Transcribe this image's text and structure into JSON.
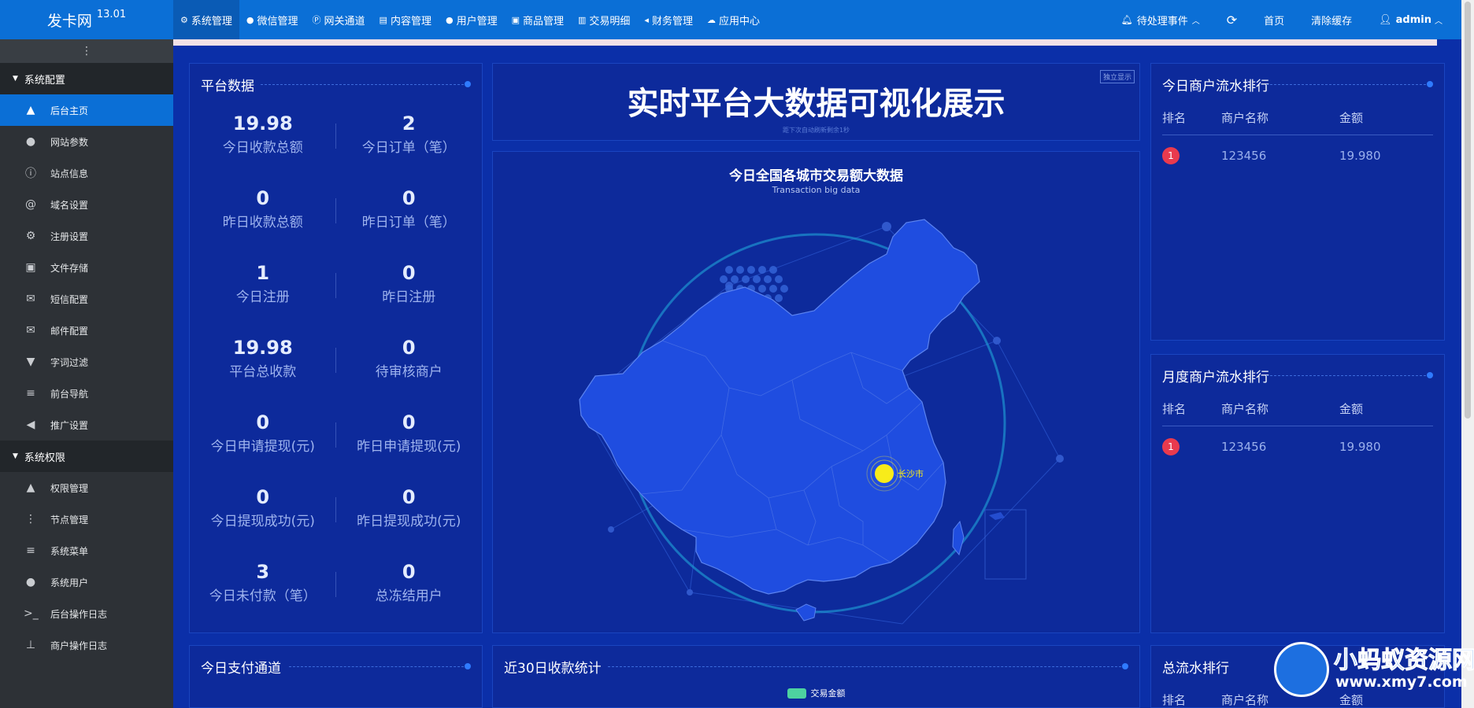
{
  "brand": {
    "name": "发卡网",
    "version": "13.01"
  },
  "topnav": [
    {
      "icon": "gear-icon",
      "glyph": "⚙",
      "label": "系统管理",
      "active": true
    },
    {
      "icon": "wechat-icon",
      "glyph": "●",
      "label": "微信管理"
    },
    {
      "icon": "gateway-icon",
      "glyph": "Ⓟ",
      "label": "网关通道"
    },
    {
      "icon": "file-icon",
      "glyph": "▤",
      "label": "内容管理"
    },
    {
      "icon": "users-icon",
      "glyph": "●",
      "label": "用户管理"
    },
    {
      "icon": "shop-icon",
      "glyph": "▣",
      "label": "商品管理"
    },
    {
      "icon": "bar-chart-icon",
      "glyph": "▥",
      "label": "交易明细"
    },
    {
      "icon": "finance-icon",
      "glyph": "◂",
      "label": "财务管理"
    },
    {
      "icon": "cloud-icon",
      "glyph": "☁",
      "label": "应用中心"
    }
  ],
  "topright": {
    "pending": "待处理事件",
    "refresh_glyph": "⟳",
    "home": "首页",
    "clear_cache": "清除缓存",
    "user": "admin"
  },
  "sidebar": {
    "toggle_glyph": "⋮",
    "groups": [
      {
        "label": "系统配置",
        "items": [
          {
            "label": "后台主页",
            "icon": "area-chart-icon",
            "glyph": "▲",
            "active": true
          },
          {
            "label": "网站参数",
            "icon": "apple-icon",
            "glyph": "●"
          },
          {
            "label": "站点信息",
            "icon": "info-icon",
            "glyph": "ⓘ"
          },
          {
            "label": "域名设置",
            "icon": "at-icon",
            "glyph": "@"
          },
          {
            "label": "注册设置",
            "icon": "gear-icon",
            "glyph": "⚙"
          },
          {
            "label": "文件存储",
            "icon": "floppy-icon",
            "glyph": "▣"
          },
          {
            "label": "短信配置",
            "icon": "envelope-icon",
            "glyph": "✉"
          },
          {
            "label": "邮件配置",
            "icon": "envelope-icon",
            "glyph": "✉"
          },
          {
            "label": "字词过滤",
            "icon": "filter-icon",
            "glyph": "▼"
          },
          {
            "label": "前台导航",
            "icon": "bars-icon",
            "glyph": "≡"
          },
          {
            "label": "推广设置",
            "icon": "bullhorn-icon",
            "glyph": "◀"
          }
        ]
      },
      {
        "label": "系统权限",
        "items": [
          {
            "label": "权限管理",
            "icon": "lock-icon",
            "glyph": "▲"
          },
          {
            "label": "节点管理",
            "icon": "dots-icon",
            "glyph": "⋮"
          },
          {
            "label": "系统菜单",
            "icon": "bars-icon",
            "glyph": "≡"
          },
          {
            "label": "系统用户",
            "icon": "users-icon",
            "glyph": "●"
          },
          {
            "label": "后台操作日志",
            "icon": "terminal-icon",
            "glyph": ">_"
          },
          {
            "label": "商户操作日志",
            "icon": "pin-icon",
            "glyph": "⊥"
          }
        ]
      }
    ]
  },
  "platform": {
    "title": "平台数据",
    "stats": [
      [
        {
          "value": "19.98",
          "label": "今日收款总额"
        },
        {
          "value": "2",
          "label": "今日订单（笔）"
        }
      ],
      [
        {
          "value": "0",
          "label": "昨日收款总额"
        },
        {
          "value": "0",
          "label": "昨日订单（笔）"
        }
      ],
      [
        {
          "value": "1",
          "label": "今日注册"
        },
        {
          "value": "0",
          "label": "昨日注册"
        }
      ],
      [
        {
          "value": "19.98",
          "label": "平台总收款"
        },
        {
          "value": "0",
          "label": "待审核商户"
        }
      ],
      [
        {
          "value": "0",
          "label": "今日申请提现(元)"
        },
        {
          "value": "0",
          "label": "昨日申请提现(元)"
        }
      ],
      [
        {
          "value": "0",
          "label": "今日提现成功(元)"
        },
        {
          "value": "0",
          "label": "昨日提现成功(元)"
        }
      ],
      [
        {
          "value": "3",
          "label": "今日未付款（笔）"
        },
        {
          "value": "0",
          "label": "总冻结用户"
        }
      ]
    ]
  },
  "header_panel": {
    "title": "实时平台大数据可视化展示",
    "note": "距下次自动刷新剩余1秒",
    "standalone": "独立显示"
  },
  "map": {
    "title": "今日全国各城市交易额大数据",
    "subtitle": "Transaction big data",
    "city": "长沙市"
  },
  "today_rank": {
    "title": "今日商户流水排行",
    "headers": [
      "排名",
      "商户名称",
      "金额"
    ],
    "rows": [
      {
        "rank": "1",
        "name": "123456",
        "amount": "19.980"
      }
    ]
  },
  "month_rank": {
    "title": "月度商户流水排行",
    "headers": [
      "排名",
      "商户名称",
      "金额"
    ],
    "rows": [
      {
        "rank": "1",
        "name": "123456",
        "amount": "19.980"
      }
    ]
  },
  "pay_channel": {
    "title": "今日支付通道"
  },
  "recent30": {
    "title": "近30日收款统计",
    "legend": "交易金额",
    "legend_color": "#4dd2a0"
  },
  "total_rank": {
    "title": "总流水排行",
    "headers": [
      "排名",
      "商户名称",
      "金额"
    ]
  },
  "watermark": {
    "text": "小蚂蚁资源网",
    "url": "www.xmy7.com"
  }
}
